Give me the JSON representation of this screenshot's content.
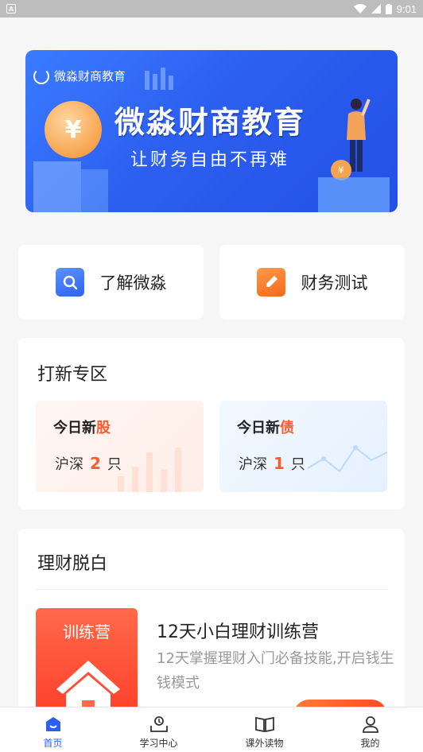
{
  "status_bar": {
    "time": "9:01"
  },
  "banner": {
    "brand_name": "微淼财商教育",
    "headline": "微淼财商教育",
    "subline": "让财务自由不再难",
    "coin_symbol": "¥"
  },
  "quick_actions": [
    {
      "label": "了解微淼",
      "icon": "search-doc-icon",
      "color": "#2e63f0"
    },
    {
      "label": "财务测试",
      "icon": "edit-doc-icon",
      "color": "#f26a1b"
    }
  ],
  "new_zone": {
    "title": "打新专区",
    "stock": {
      "tag_prefix": "今日新",
      "tag_highlight": "股",
      "market": "沪深",
      "count": "2",
      "unit": "只"
    },
    "bond": {
      "tag_prefix": "今日新",
      "tag_highlight": "债",
      "market": "沪深",
      "count": "1",
      "unit": "只"
    }
  },
  "beginner": {
    "title": "理财脱白",
    "camp": {
      "thumb_label": "训练营",
      "title": "12天小白理财训练营",
      "description": "12天掌握理财入门必备技能,开启钱生钱模式"
    }
  },
  "tabbar": [
    {
      "label": "首页",
      "icon": "home-icon",
      "active": true
    },
    {
      "label": "学习中心",
      "icon": "learning-center-icon",
      "active": false
    },
    {
      "label": "课外读物",
      "icon": "book-icon",
      "active": false
    },
    {
      "label": "我的",
      "icon": "profile-icon",
      "active": false
    }
  ],
  "colors": {
    "accent": "#2c5ff0",
    "highlight": "#ff5a2c"
  }
}
